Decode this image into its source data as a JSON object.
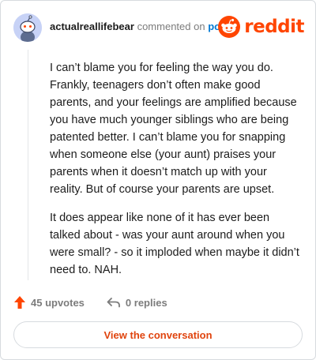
{
  "header": {
    "username": "actualreallifebear",
    "action": "commented on",
    "target": "post",
    "brand": "reddit"
  },
  "comment": {
    "paragraphs": [
      "I can’t blame you for feeling the way you do. Frankly, teenagers don’t often make good parents, and your feelings are amplified because you have much younger siblings who are being patented better. I can’t blame you for snapping when someone else (your aunt) praises your parents when it doesn’t match up with your reality. But of course your parents are upset.",
      "It does appear like none of it has ever been talked about - was your aunt around when you were small? - so it imploded when maybe it didn’t need to. NAH."
    ]
  },
  "actions": {
    "upvotes": "45 upvotes",
    "replies": "0 replies"
  },
  "cta": {
    "label": "View the conversation"
  },
  "colors": {
    "accent": "#ff4500",
    "link": "#0079d3",
    "muted": "#7c7c7c",
    "avatar_bg": "#c7d2f6"
  },
  "icons": {
    "avatar": "snoo-avatar-icon",
    "brand": "reddit-logo-icon",
    "upvote": "upvote-arrow-icon",
    "reply": "reply-arrow-icon"
  }
}
